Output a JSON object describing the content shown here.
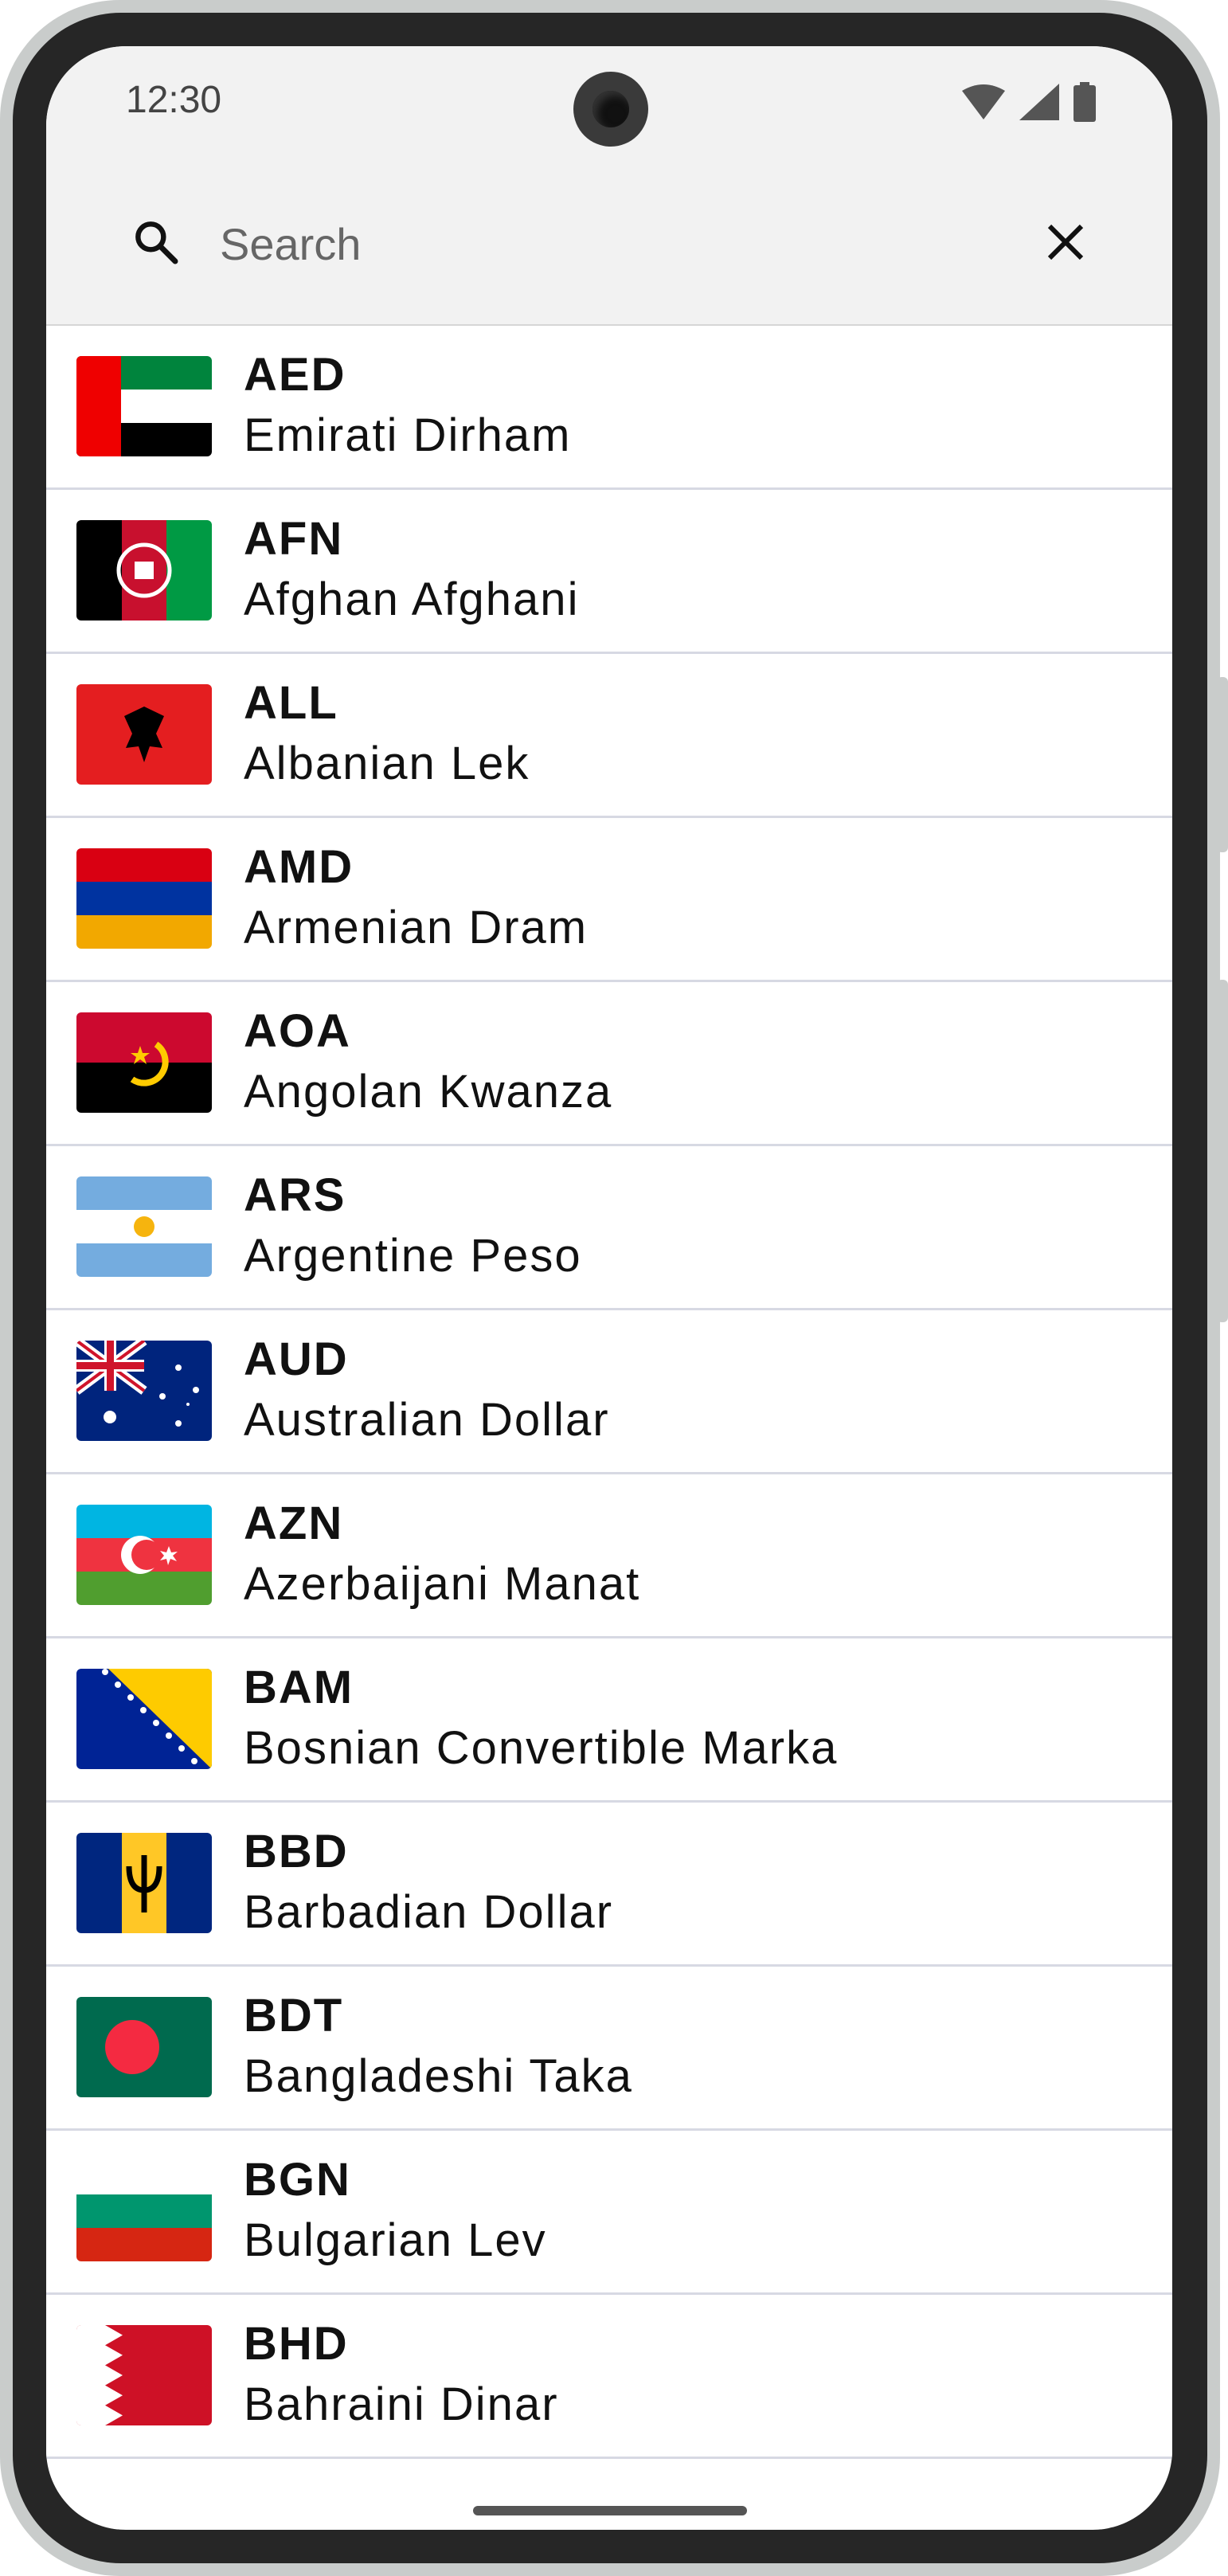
{
  "status_bar": {
    "time": "12:30"
  },
  "search": {
    "placeholder": "Search",
    "value": ""
  },
  "currencies": [
    {
      "code": "AED",
      "name": "Emirati Dirham"
    },
    {
      "code": "AFN",
      "name": "Afghan Afghani"
    },
    {
      "code": "ALL",
      "name": "Albanian Lek"
    },
    {
      "code": "AMD",
      "name": "Armenian Dram"
    },
    {
      "code": "AOA",
      "name": "Angolan Kwanza"
    },
    {
      "code": "ARS",
      "name": "Argentine Peso"
    },
    {
      "code": "AUD",
      "name": "Australian Dollar"
    },
    {
      "code": "AZN",
      "name": "Azerbaijani Manat"
    },
    {
      "code": "BAM",
      "name": "Bosnian Convertible Marka"
    },
    {
      "code": "BBD",
      "name": "Barbadian Dollar"
    },
    {
      "code": "BDT",
      "name": "Bangladeshi Taka"
    },
    {
      "code": "BGN",
      "name": "Bulgarian Lev"
    },
    {
      "code": "BHD",
      "name": "Bahraini Dinar"
    }
  ],
  "icons": [
    "search-icon",
    "close-icon",
    "wifi-icon",
    "signal-icon",
    "battery-icon"
  ]
}
